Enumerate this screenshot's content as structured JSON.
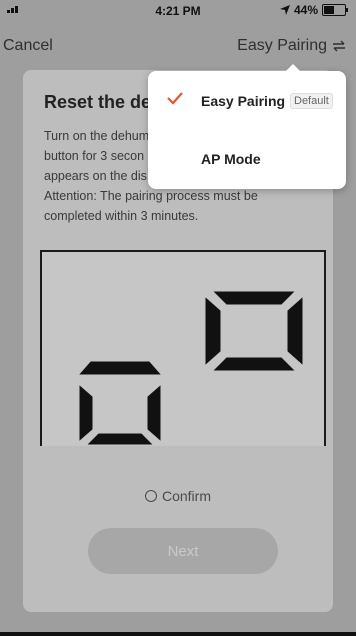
{
  "status_bar": {
    "time": "4:21 PM",
    "battery_percent": "44%",
    "battery_level": 0.44
  },
  "nav": {
    "cancel_label": "Cancel",
    "mode_label": "Easy Pairing",
    "mode_icon": "swap-arrows-icon"
  },
  "card": {
    "title": "Reset the dev",
    "description": [
      "Turn on the dehum",
      "button for 3 secon",
      "appears on the dis",
      "Attention: The pairing process must be",
      "completed within 3 minutes."
    ],
    "confirm_label": "Confirm",
    "next_label": "Next"
  },
  "dropdown": {
    "items": [
      {
        "label": "Easy Pairing",
        "badge": "Default",
        "selected": true
      },
      {
        "label": "AP Mode",
        "selected": false
      }
    ]
  },
  "colors": {
    "accent": "#e8542c",
    "overlay": "#9e9e9e",
    "card": "#bdbdbd",
    "segment": "#111111"
  }
}
